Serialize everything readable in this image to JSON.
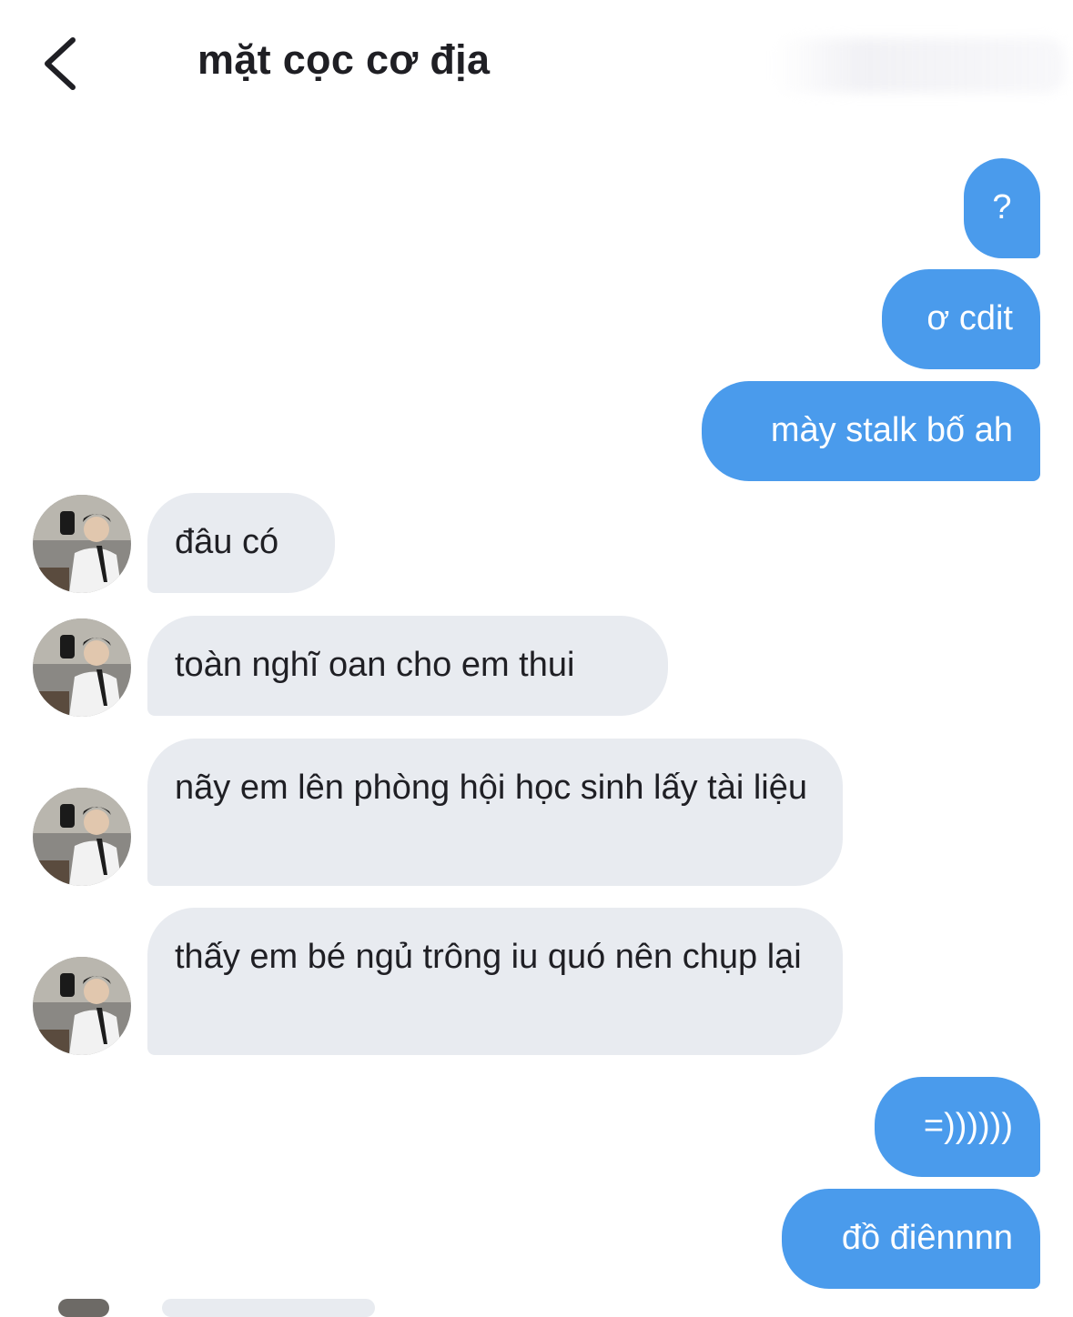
{
  "header": {
    "title": "mặt cọc cơ địa"
  },
  "colors": {
    "outgoing_bubble": "#4a9bec",
    "incoming_bubble": "#e8ebf0",
    "text": "#1f1f24"
  },
  "messages": [
    {
      "direction": "outgoing",
      "text": "?"
    },
    {
      "direction": "outgoing",
      "text": "ơ cdit"
    },
    {
      "direction": "outgoing",
      "text": "mày stalk bố ah"
    },
    {
      "direction": "incoming",
      "text": "đâu có"
    },
    {
      "direction": "incoming",
      "text": "toàn nghĩ oan cho em thui"
    },
    {
      "direction": "incoming",
      "text": "nãy em lên phòng hội học sinh lấy tài liệu"
    },
    {
      "direction": "incoming",
      "text": "thấy em bé ngủ trông iu quó nên chụp lại"
    },
    {
      "direction": "outgoing",
      "text": "=))))))"
    },
    {
      "direction": "outgoing",
      "text": "đồ điênnnn"
    }
  ],
  "icons": {
    "back": "chevron-left-icon",
    "avatar": "contact-avatar"
  }
}
